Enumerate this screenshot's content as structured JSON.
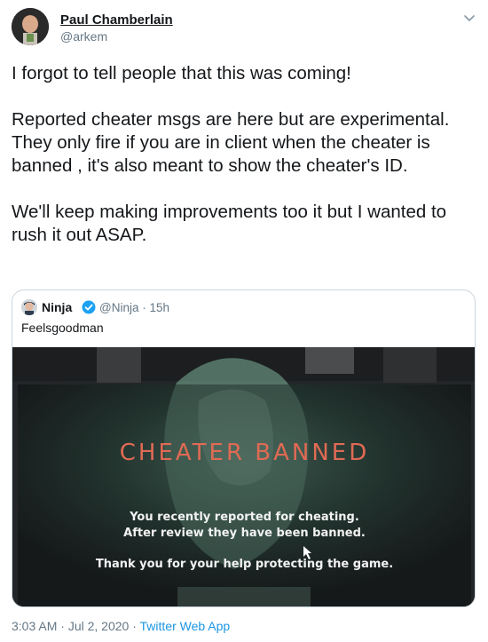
{
  "author": {
    "name": "Paul Chamberlain",
    "handle": "@arkem"
  },
  "tweet": {
    "paragraphs": [
      "I forgot to tell people that this was coming!",
      "Reported cheater msgs are here but are experimental. They only fire if you are in client when the cheater is banned , it's also meant to show the cheater's ID.",
      "We'll keep making improvements too it but I wanted to rush it out ASAP."
    ]
  },
  "quoted": {
    "name": "Ninja",
    "handle": "@Ninja",
    "time": "15h",
    "text": "Feelsgoodman",
    "media": {
      "title": "CHEATER BANNED",
      "line1": "You recently reported for cheating.",
      "line2": "After review they have been banned.",
      "line3": "Thank you for your help protecting the game."
    }
  },
  "footer": {
    "time": "3:03 AM",
    "separator": "·",
    "date": "Jul 2, 2020",
    "app": "Twitter Web App"
  },
  "icons": {
    "caret": "chevron-down-icon",
    "verified": "verified-badge-icon"
  },
  "colors": {
    "link": "#1b95e0",
    "secondary_text": "#657786",
    "verified": "#1da1f2",
    "banner_title": "#e06a54"
  }
}
